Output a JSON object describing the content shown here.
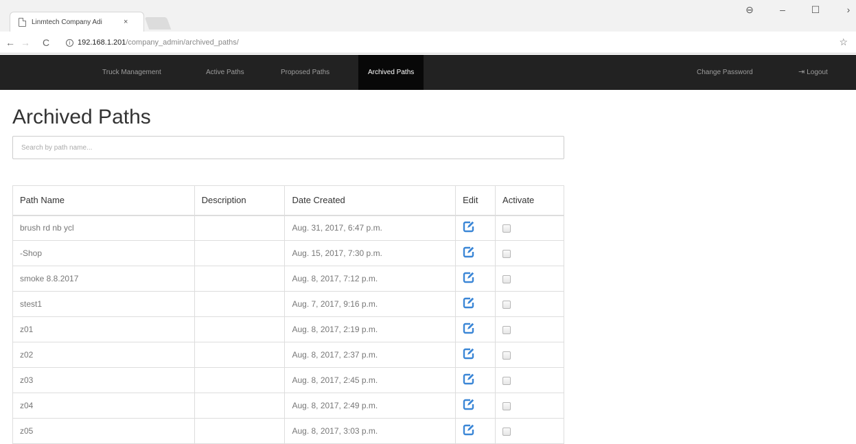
{
  "browser": {
    "tab_title": "Linmtech Company Adi",
    "tab_close": "×",
    "url_host": "192.168.1.201",
    "url_path": "/company_admin/archived_paths/",
    "back": "←",
    "forward": "→",
    "reload": "C",
    "star": "☆",
    "account": "⊖",
    "minimize": "–",
    "maximize": "☐",
    "close": "›"
  },
  "navbar": {
    "items": [
      {
        "label": "Truck Management"
      },
      {
        "label": "Active Paths"
      },
      {
        "label": "Proposed Paths"
      },
      {
        "label": "Archived Paths"
      }
    ],
    "change_password": "Change Password",
    "logout": "Logout",
    "logout_icon": "⇥"
  },
  "page": {
    "title": "Archived Paths",
    "search_placeholder": "Search by path name..."
  },
  "table": {
    "headers": {
      "name": "Path Name",
      "description": "Description",
      "date": "Date Created",
      "edit": "Edit",
      "activate": "Activate"
    },
    "rows": [
      {
        "name": "brush rd nb ycl",
        "description": "",
        "date": "Aug. 31, 2017, 6:47 p.m."
      },
      {
        "name": "-Shop",
        "description": "",
        "date": "Aug. 15, 2017, 7:30 p.m."
      },
      {
        "name": "smoke 8.8.2017",
        "description": "",
        "date": "Aug. 8, 2017, 7:12 p.m."
      },
      {
        "name": "stest1",
        "description": "",
        "date": "Aug. 7, 2017, 9:16 p.m."
      },
      {
        "name": "z01",
        "description": "",
        "date": "Aug. 8, 2017, 2:19 p.m."
      },
      {
        "name": "z02",
        "description": "",
        "date": "Aug. 8, 2017, 2:37 p.m."
      },
      {
        "name": "z03",
        "description": "",
        "date": "Aug. 8, 2017, 2:45 p.m."
      },
      {
        "name": "z04",
        "description": "",
        "date": "Aug. 8, 2017, 2:49 p.m."
      },
      {
        "name": "z05",
        "description": "",
        "date": "Aug. 8, 2017, 3:03 p.m."
      }
    ]
  },
  "colors": {
    "navbar_bg": "#222222",
    "navbar_active_bg": "#080808",
    "edit_icon": "#3a86d6"
  }
}
